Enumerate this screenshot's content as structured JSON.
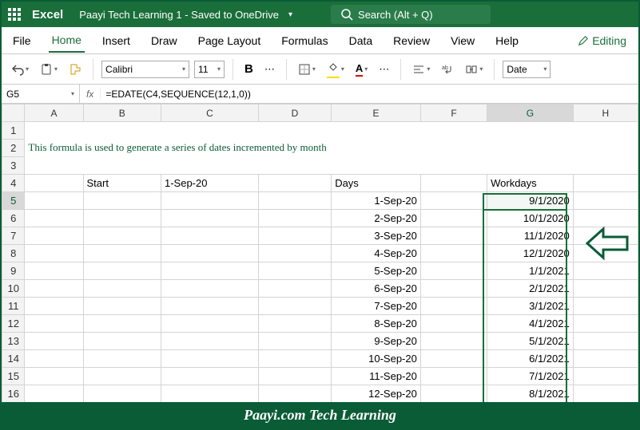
{
  "title": {
    "app": "Excel",
    "doc": "Paayi Tech Learning 1  -  Saved to OneDrive"
  },
  "search": {
    "placeholder": "Search (Alt + Q)"
  },
  "tabs": {
    "file": "File",
    "home": "Home",
    "insert": "Insert",
    "draw": "Draw",
    "layout": "Page Layout",
    "formulas": "Formulas",
    "data": "Data",
    "review": "Review",
    "view": "View",
    "help": "Help",
    "editing": "Editing"
  },
  "toolbar": {
    "font": "Calibri",
    "size": "11",
    "format": "Date"
  },
  "formula": {
    "cell": "G5",
    "text": "=EDATE(C4,SEQUENCE(12,1,0))"
  },
  "cols": [
    "A",
    "B",
    "C",
    "D",
    "E",
    "F",
    "G",
    "H"
  ],
  "rows": [
    "1",
    "2",
    "3",
    "4",
    "5",
    "6",
    "7",
    "8",
    "9",
    "10",
    "11",
    "12",
    "13",
    "14",
    "15",
    "16"
  ],
  "sheet": {
    "title_line": "This formula is used to generate a series of dates incremented by month",
    "h_start": "Start",
    "h_date": "1-Sep-20",
    "h_days": "Days",
    "h_work": "Workdays",
    "days": [
      "1-Sep-20",
      "2-Sep-20",
      "3-Sep-20",
      "4-Sep-20",
      "5-Sep-20",
      "6-Sep-20",
      "7-Sep-20",
      "8-Sep-20",
      "9-Sep-20",
      "10-Sep-20",
      "11-Sep-20",
      "12-Sep-20"
    ],
    "work": [
      "9/1/2020",
      "10/1/2020",
      "11/1/2020",
      "12/1/2020",
      "1/1/2021",
      "2/1/2021",
      "3/1/2021",
      "4/1/2021",
      "5/1/2021",
      "6/1/2021",
      "7/1/2021",
      "8/1/2021"
    ]
  },
  "footer": "Paayi.com Tech Learning"
}
